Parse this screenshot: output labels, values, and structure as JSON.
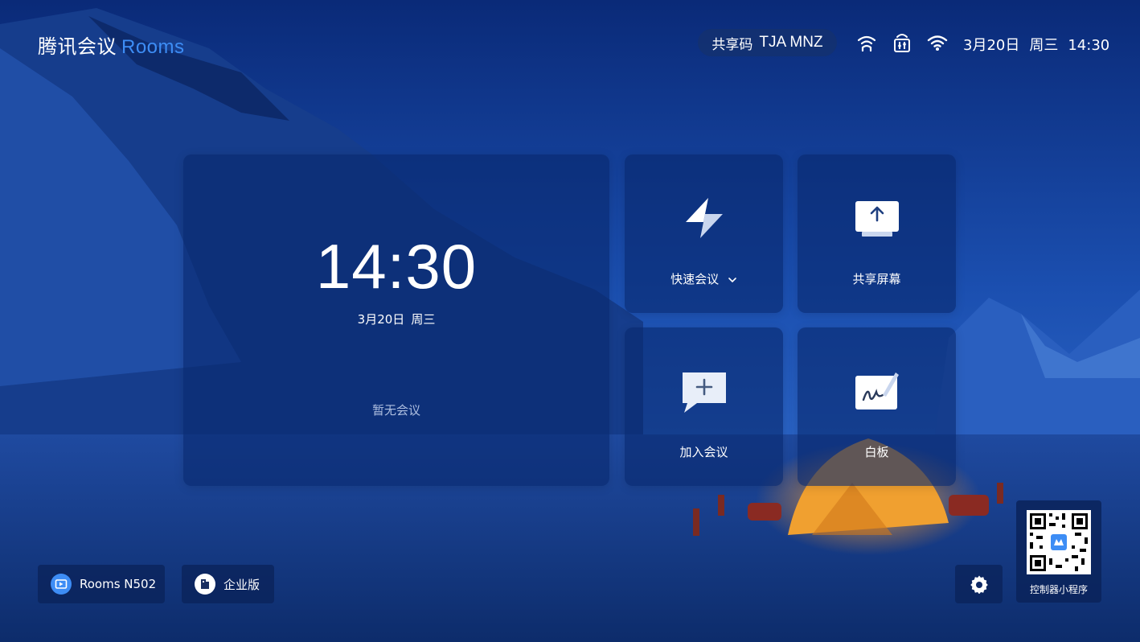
{
  "app": {
    "brand": "腾讯会议",
    "product": "Rooms"
  },
  "status_bar": {
    "share_code_label": "共享码",
    "share_code": "TJA MNZ",
    "icons": [
      "cast-icon",
      "controller-icon",
      "wifi-icon"
    ],
    "date": "3月20日",
    "weekday": "周三",
    "time": "14:30"
  },
  "main_card": {
    "time": "14:30",
    "date": "3月20日",
    "weekday": "周三",
    "empty_text": "暂无会议"
  },
  "tiles": [
    {
      "label": "快速会议",
      "icon": "lightning-icon",
      "has_dropdown": true
    },
    {
      "label": "共享屏幕",
      "icon": "screen-share-icon"
    },
    {
      "label": "加入会议",
      "icon": "join-meeting-icon"
    },
    {
      "label": "白板",
      "icon": "whiteboard-icon"
    }
  ],
  "bottom": {
    "room_name": "Rooms N502",
    "edition": "企业版",
    "qr_label": "控制器小程序",
    "settings_icon": "gear-icon"
  },
  "colors": {
    "accent": "#3d8df5",
    "card_bg": "#08286e",
    "tent": "#f0a030"
  }
}
